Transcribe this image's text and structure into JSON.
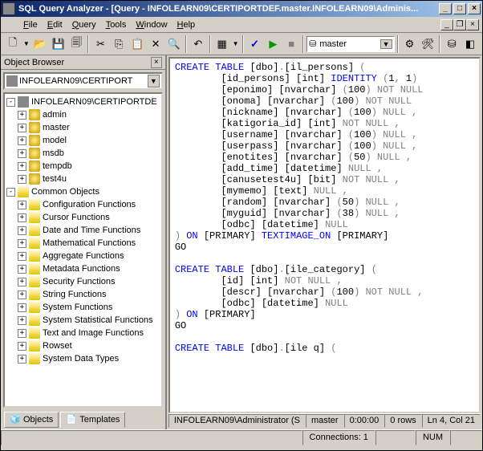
{
  "titlebar": {
    "text": "SQL Query Analyzer - [Query - INFOLEARN09\\CERTIPORTDEF.master.INFOLEARN09\\Adminis..."
  },
  "menu": {
    "file": "File",
    "edit": "Edit",
    "query": "Query",
    "tools": "Tools",
    "window": "Window",
    "help": "Help"
  },
  "toolbar": {
    "db_combo_icon": "⛁",
    "db_combo_value": "master"
  },
  "object_browser": {
    "title": "Object Browser",
    "combo_value": "INFOLEARN09\\CERTIPORT",
    "root": "INFOLEARN09\\CERTIPORTDE",
    "databases": [
      "admin",
      "master",
      "model",
      "msdb",
      "tempdb",
      "test4u"
    ],
    "common_label": "Common Objects",
    "folders": [
      "Configuration Functions",
      "Cursor Functions",
      "Date and Time Functions",
      "Mathematical Functions",
      "Aggregate Functions",
      "Metadata Functions",
      "Security Functions",
      "String Functions",
      "System Functions",
      "System Statistical Functions",
      "Text and Image Functions",
      "Rowset",
      "System Data Types"
    ],
    "tab_objects": "Objects",
    "tab_templates": "Templates"
  },
  "sql": {
    "lines": [
      {
        "t": "kw",
        "s": "CREATE TABLE"
      },
      {
        "t": "p",
        "s": " [dbo]"
      },
      {
        "t": "g",
        "s": "."
      },
      {
        "t": "p",
        "s": "[il_persons] "
      },
      {
        "t": "g",
        "s": "("
      },
      {
        "br": 1
      },
      {
        "pad": 8
      },
      {
        "t": "p",
        "s": "[id_persons] [int] "
      },
      {
        "t": "kw",
        "s": "IDENTITY "
      },
      {
        "t": "g",
        "s": "("
      },
      {
        "t": "p",
        "s": "1"
      },
      {
        "t": "g",
        "s": ","
      },
      {
        "t": "p",
        "s": " 1"
      },
      {
        "t": "g",
        "s": ")"
      },
      {
        "br": 1
      },
      {
        "pad": 8
      },
      {
        "t": "p",
        "s": "[eponimo] [nvarchar] "
      },
      {
        "t": "g",
        "s": "("
      },
      {
        "t": "p",
        "s": "100"
      },
      {
        "t": "g",
        "s": ") NOT NULL"
      },
      {
        "br": 1
      },
      {
        "pad": 8
      },
      {
        "t": "p",
        "s": "[onoma] [nvarchar] "
      },
      {
        "t": "g",
        "s": "("
      },
      {
        "t": "p",
        "s": "100"
      },
      {
        "t": "g",
        "s": ") NOT NULL"
      },
      {
        "br": 1
      },
      {
        "pad": 8
      },
      {
        "t": "p",
        "s": "[nickname] [nvarchar] "
      },
      {
        "t": "g",
        "s": "("
      },
      {
        "t": "p",
        "s": "100"
      },
      {
        "t": "g",
        "s": ") NULL ,"
      },
      {
        "br": 1
      },
      {
        "pad": 8
      },
      {
        "t": "p",
        "s": "[katigoria_id] [int] "
      },
      {
        "t": "g",
        "s": "NOT NULL ,"
      },
      {
        "br": 1
      },
      {
        "pad": 8
      },
      {
        "t": "p",
        "s": "[username] [nvarchar] "
      },
      {
        "t": "g",
        "s": "("
      },
      {
        "t": "p",
        "s": "100"
      },
      {
        "t": "g",
        "s": ") NULL ,"
      },
      {
        "br": 1
      },
      {
        "pad": 8
      },
      {
        "t": "p",
        "s": "[userpass] [nvarchar] "
      },
      {
        "t": "g",
        "s": "("
      },
      {
        "t": "p",
        "s": "100"
      },
      {
        "t": "g",
        "s": ") NULL ,"
      },
      {
        "br": 1
      },
      {
        "pad": 8
      },
      {
        "t": "p",
        "s": "[enotites] [nvarchar] "
      },
      {
        "t": "g",
        "s": "("
      },
      {
        "t": "p",
        "s": "50"
      },
      {
        "t": "g",
        "s": ") NULL ,"
      },
      {
        "br": 1
      },
      {
        "pad": 8
      },
      {
        "t": "p",
        "s": "[add_time] [datetime] "
      },
      {
        "t": "g",
        "s": "NULL ,"
      },
      {
        "br": 1
      },
      {
        "pad": 8
      },
      {
        "t": "p",
        "s": "[canusetest4u] [bit] "
      },
      {
        "t": "g",
        "s": "NOT NULL ,"
      },
      {
        "br": 1
      },
      {
        "pad": 8
      },
      {
        "t": "p",
        "s": "[mymemo] [text] "
      },
      {
        "t": "g",
        "s": "NULL ,"
      },
      {
        "br": 1
      },
      {
        "pad": 8
      },
      {
        "t": "p",
        "s": "[random] [nvarchar] "
      },
      {
        "t": "g",
        "s": "("
      },
      {
        "t": "p",
        "s": "50"
      },
      {
        "t": "g",
        "s": ") NULL ,"
      },
      {
        "br": 1
      },
      {
        "pad": 8
      },
      {
        "t": "p",
        "s": "[myguid] [nvarchar] "
      },
      {
        "t": "g",
        "s": "("
      },
      {
        "t": "p",
        "s": "38"
      },
      {
        "t": "g",
        "s": ") NULL ,"
      },
      {
        "br": 1
      },
      {
        "pad": 8
      },
      {
        "t": "p",
        "s": "[odbc] [datetime] "
      },
      {
        "t": "g",
        "s": "NULL"
      },
      {
        "br": 1
      },
      {
        "t": "g",
        "s": ")"
      },
      {
        "t": "kw",
        "s": " ON "
      },
      {
        "t": "p",
        "s": "[PRIMARY] "
      },
      {
        "t": "kw",
        "s": "TEXTIMAGE_ON "
      },
      {
        "t": "p",
        "s": "[PRIMARY]"
      },
      {
        "br": 1
      },
      {
        "t": "p",
        "s": "GO"
      },
      {
        "br": 1
      },
      {
        "t": "p",
        "s": " "
      },
      {
        "br": 1
      },
      {
        "t": "kw",
        "s": "CREATE TABLE"
      },
      {
        "t": "p",
        "s": " [dbo]"
      },
      {
        "t": "g",
        "s": "."
      },
      {
        "t": "p",
        "s": "[ile_category] "
      },
      {
        "t": "g",
        "s": "("
      },
      {
        "br": 1
      },
      {
        "pad": 8
      },
      {
        "t": "p",
        "s": "[id] [int] "
      },
      {
        "t": "g",
        "s": "NOT NULL ,"
      },
      {
        "br": 1
      },
      {
        "pad": 8
      },
      {
        "t": "p",
        "s": "[descr] [nvarchar] "
      },
      {
        "t": "g",
        "s": "("
      },
      {
        "t": "p",
        "s": "100"
      },
      {
        "t": "g",
        "s": ") NOT NULL ,"
      },
      {
        "br": 1
      },
      {
        "pad": 8
      },
      {
        "t": "p",
        "s": "[odbc] [datetime] "
      },
      {
        "t": "g",
        "s": "NULL"
      },
      {
        "br": 1
      },
      {
        "t": "g",
        "s": ")"
      },
      {
        "t": "kw",
        "s": " ON "
      },
      {
        "t": "p",
        "s": "[PRIMARY]"
      },
      {
        "br": 1
      },
      {
        "t": "p",
        "s": "GO"
      },
      {
        "br": 1
      },
      {
        "t": "p",
        "s": " "
      },
      {
        "br": 1
      },
      {
        "t": "kw",
        "s": "CREATE TABLE"
      },
      {
        "t": "p",
        "s": " [dbo]"
      },
      {
        "t": "g",
        "s": "."
      },
      {
        "t": "p",
        "s": "[ile q] "
      },
      {
        "t": "g",
        "s": "("
      }
    ]
  },
  "editor_status": {
    "conn": "INFOLEARN09\\Administrator (S",
    "db": "master",
    "time": "0:00:00",
    "rows": "0 rows",
    "pos": "Ln 4, Col 21"
  },
  "statusbar": {
    "connections": "Connections: 1",
    "num": "NUM"
  }
}
